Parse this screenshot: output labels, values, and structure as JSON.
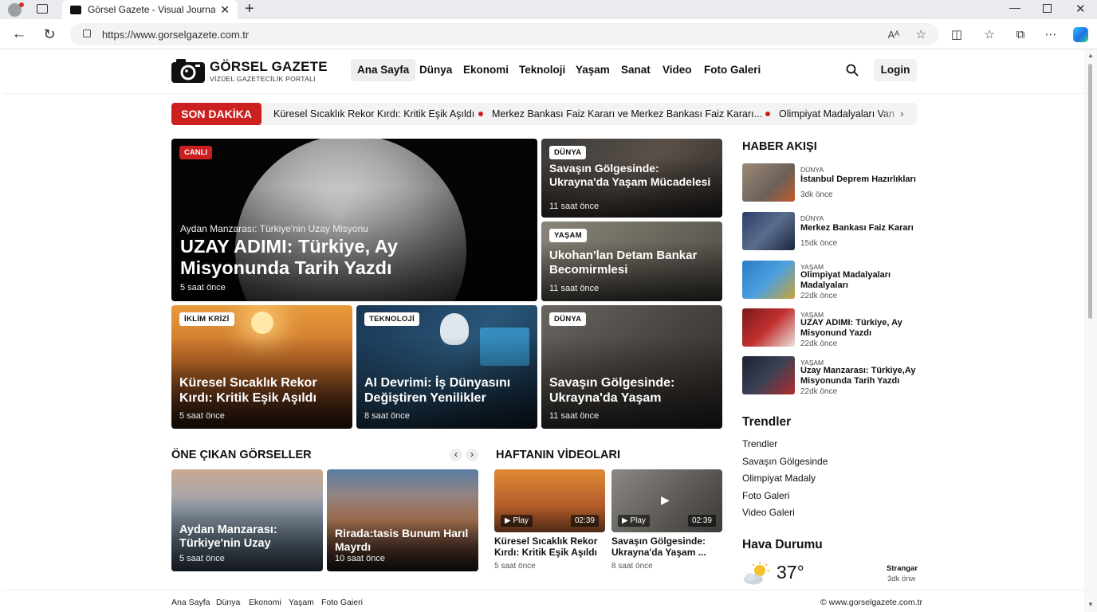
{
  "browser": {
    "tab_title": "Görsel Gazete - Visual Journalism",
    "url": "https://www.gorselgazete.com.tr"
  },
  "site": {
    "name": "GÖRSEL GAZETE",
    "tagline": "VİZÜEL GAZETECİLİK PORTALI",
    "login_label": "Login",
    "nav": [
      "Ana Sayfa",
      "Dünya",
      "Ekonomi",
      "Teknoloji",
      "Yaşam",
      "Sanat",
      "Video",
      "Foto Galeri"
    ]
  },
  "breaking": {
    "label": "SON DAKİKA",
    "items": [
      "Küresel Sıcaklık Rekor Kırdı: Kritik Eşik Aşıldı",
      "Merkez Bankası Faiz Kararı ve Merkez Bankası Faiz Kararı...",
      "Olimpiyat Madalyaları Van"
    ]
  },
  "hero": {
    "badge": "CANLI",
    "kicker": "Aydan Manzarası: Türkiye'nin Uzay Misyonu",
    "title": "UZAY ADIMI: Türkiye, Ay Misyonunda Tarih Yazdı",
    "time": "5 saat önce"
  },
  "cards": [
    {
      "badge": "DÜNYA",
      "title": "Savaşın Gölgesinde: Ukrayna'da Yaşam Mücadelesi",
      "time": "11 saat önce"
    },
    {
      "badge": "YAŞAM",
      "title": "Ukohan'lan Detam Bankar Becomirmlesi",
      "time": "11 saat önce"
    },
    {
      "badge": "İKLİM KRİZİ",
      "title": "Küresel Sıcaklık Rekor Kırdı: Kritik Eşik Aşıldı",
      "time": "5 saat önce"
    },
    {
      "badge": "TEKNOLOJİ",
      "title": "AI Devrimi: İş Dünyasını Değiştiren Yenilikler",
      "time": "8 saat önce"
    },
    {
      "badge": "DÜNYA",
      "title": "Savaşın Gölgesinde: Ukrayna'da Yaşam",
      "time": "11 saat önce"
    }
  ],
  "featured_images": {
    "heading": "ÖNE ÇIKAN GÖRSELLER",
    "items": [
      {
        "title": "Aydan Manzarası: Türkiye'nin Uzay",
        "time": "5 saat önce"
      },
      {
        "title": "Rirada:tasis Bunum Harıl Mayrdı",
        "time": "10 saat önce"
      }
    ]
  },
  "videos": {
    "heading": "HAFTANIN VİDEOLARI",
    "items": [
      {
        "play": "Play",
        "duration": "02:39",
        "title": "Küresel Sıcaklık Rekor Kırdı: Kritik Eşik Aşıldı",
        "time": "5 saat önce"
      },
      {
        "play": "Play",
        "duration": "02:39",
        "title": "Savaşın Gölgesinde: Ukrayna'da Yaşam ...",
        "time": "8 saat önce"
      }
    ]
  },
  "news_feed": {
    "heading": "HABER AKIŞI",
    "items": [
      {
        "category": "DÜNYA",
        "title": "İstanbul Deprem Hazırlıkları",
        "time": "3dk önce"
      },
      {
        "category": "DÜNYA",
        "title": "Merkez Bankası Faiz Kararı",
        "time": "15dk önce"
      },
      {
        "category": "YAŞAM",
        "title": "Olimpiyat Madalyaları Madalyaları",
        "time": "22dk önce"
      },
      {
        "category": "YAŞAM",
        "title": "UZAY ADIMI: Türkiye, Ay Misyonund Yazdı",
        "time": "22dk önce"
      },
      {
        "category": "YAŞAM",
        "title": "Uzay Manzarası: Türkiye,Ay Misyonunda Tarih Yazdı",
        "time": "22dk önce"
      }
    ]
  },
  "trends": {
    "heading": "Trendler",
    "items": [
      "Trendler",
      "Savaşın Gölgesinde",
      "Olimpiyat Madaly",
      "Foto Galeri",
      "Video Galeri"
    ]
  },
  "weather": {
    "heading": "Hava Durumu",
    "temp": "37°",
    "label": "Strangar",
    "time": "3dk önw"
  },
  "footer": {
    "links": [
      "Ana Sayfa",
      "Dünya",
      "Ekonomi",
      "Yaşam",
      "Foto Gaieri"
    ],
    "copyright": "© www.gorselgazete.com.tr"
  },
  "colors": {
    "accent": "#cc1f1f",
    "nav_active_bg": "#eeeeee"
  }
}
